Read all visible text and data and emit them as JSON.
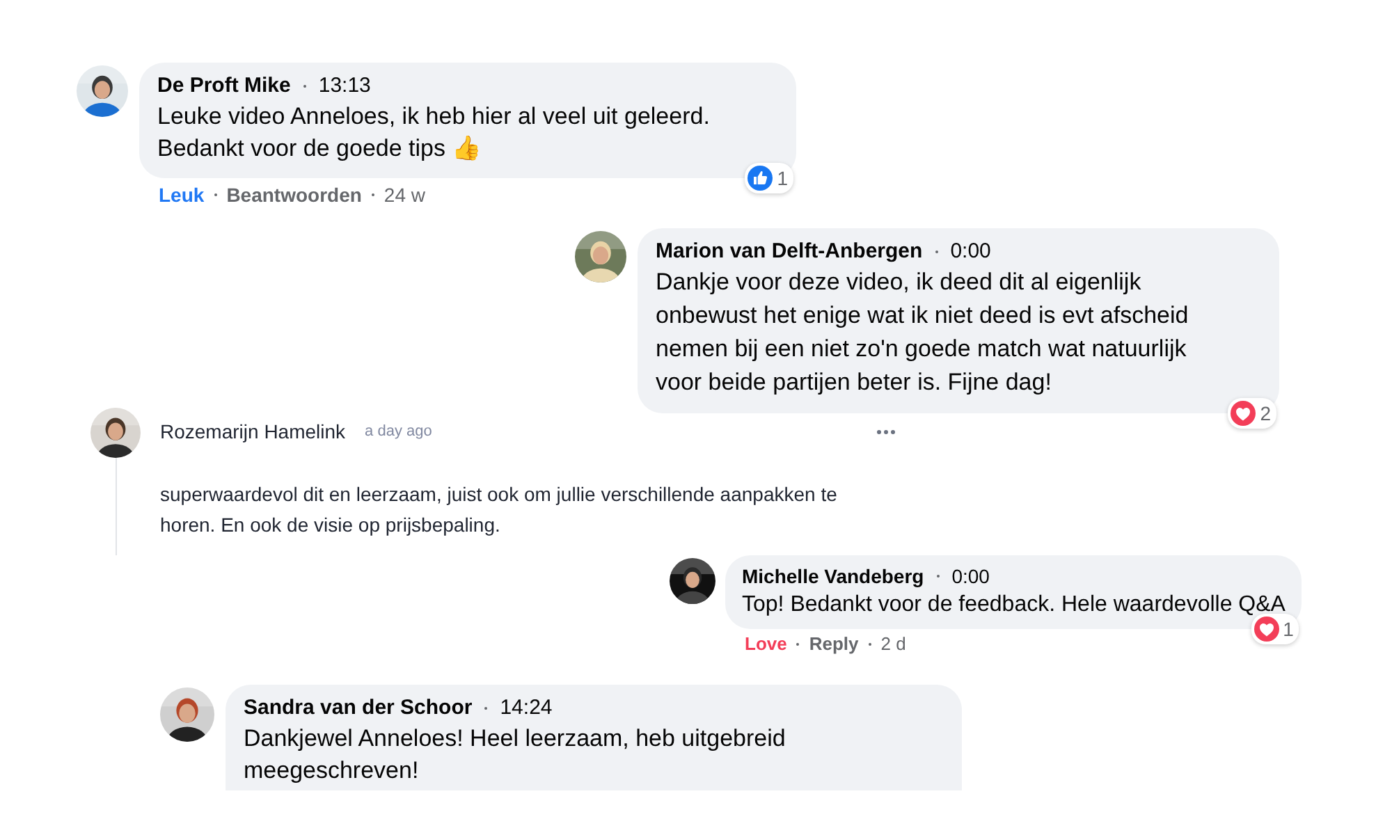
{
  "comments": [
    {
      "kind": "bubble",
      "author": "De Proft Mike",
      "time": "13:13",
      "text": "Leuke video Anneloes, ik heb hier al veel uit geleerd. Bedankt voor de goede tips 👍",
      "reaction": {
        "kind": "like",
        "count": "1"
      },
      "actions": [
        {
          "label": "Leuk",
          "kind": "like"
        },
        {
          "label": "Beantwoorden",
          "kind": "reply"
        }
      ],
      "age": "24 w"
    },
    {
      "kind": "bubble",
      "author": "Marion van Delft-Anbergen",
      "time": "0:00",
      "text": "Dankje voor deze video, ik deed dit al eigenlijk onbewust het enige wat ik niet deed is evt afscheid nemen bij een niet zo'n goede match wat natuurlijk voor beide partijen beter is. Fijne dag!",
      "reaction": {
        "kind": "love",
        "count": "2"
      }
    },
    {
      "kind": "thread",
      "author": "Rozemarijn Hamelink",
      "time": "a day ago",
      "text": "superwaardevol dit en leerzaam, juist ook om jullie verschillende aanpakken te horen. En ook de visie op prijsbepaling."
    },
    {
      "kind": "bubble",
      "author": "Michelle Vandeberg",
      "time": "0:00",
      "text": "Top! Bedankt voor de feedback. Hele waardevolle Q&A",
      "reaction": {
        "kind": "love",
        "count": "1"
      },
      "actions": [
        {
          "label": "Love",
          "kind": "love"
        },
        {
          "label": "Reply",
          "kind": "reply"
        }
      ],
      "age": "2 d"
    },
    {
      "kind": "bubble",
      "author": "Sandra van der Schoor",
      "time": "14:24",
      "text": "Dankjewel Anneloes! Heel leerzaam, heb uitgebreid meegeschreven!"
    }
  ]
}
